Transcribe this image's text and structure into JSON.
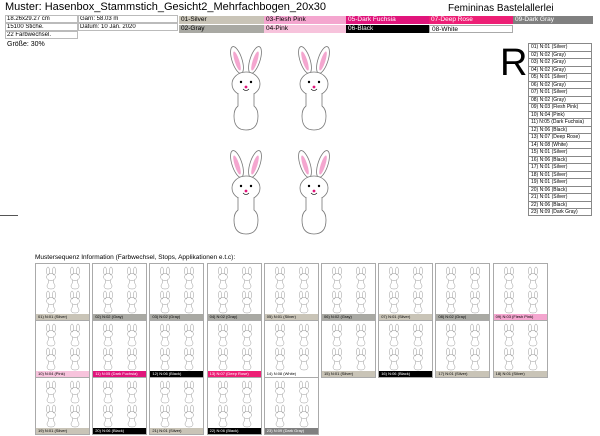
{
  "header": {
    "title": "Muster: Hasenbox_Stammstich_Gesicht2_Mehrfachbogen_20x30",
    "brand": "Femininas Bastelallerlei",
    "size": "18.26x29.27 cm",
    "garn": "Garn: 58.03 m",
    "stitches": "15100 Stiche.",
    "date": "Datum: 10 Jan. 2020",
    "color_changes": "22 Farbwechsel.",
    "scale": "Größe: 30%"
  },
  "swatches": [
    {
      "label": "01-Silver",
      "bg": "#c9c4b7",
      "fg": "#000000"
    },
    {
      "label": "03-Flesh Pink",
      "bg": "#f4a6cf",
      "fg": "#000000"
    },
    {
      "label": "05-Dark Fuchsia",
      "bg": "#e0157b",
      "fg": "#ffffff"
    },
    {
      "label": "07-Deep Rose",
      "bg": "#ed1f75",
      "fg": "#ffffff"
    },
    {
      "label": "09-Dark Gray",
      "bg": "#808080",
      "fg": "#ffffff"
    },
    {
      "label": "02-Gray",
      "bg": "#a9a9a3",
      "fg": "#000000"
    },
    {
      "label": "04-Pink",
      "bg": "#f7c3dc",
      "fg": "#000000"
    },
    {
      "label": "06-Black",
      "bg": "#000000",
      "fg": "#ffffff"
    },
    {
      "label": "08-White",
      "bg": "#ffffff",
      "fg": "#000000"
    }
  ],
  "big_letter": "R",
  "sequence": [
    "01) N:01 (Silver)",
    "02) N:02 (Gray)",
    "03) N:02 (Gray)",
    "04) N:02 (Gray)",
    "05) N:01 (Silver)",
    "06) N:02 (Gray)",
    "07) N:01 (Silver)",
    "08) N:02 (Gray)",
    "09) N:03 (Flesh Pink)",
    "10) N:04 (Pink)",
    "11) N:05 (Dark Fuchsia)",
    "12) N:06 (Black)",
    "13) N:07 (Deep Rose)",
    "14) N:08 (White)",
    "15) N:01 (Silver)",
    "16) N:06 (Black)",
    "17) N:01 (Silver)",
    "18) N:01 (Silver)",
    "19) N:01 (Silver)",
    "20) N:06 (Black)",
    "21) N:01 (Silver)",
    "22) N:06 (Black)",
    "23) N:09 (Dark Gray)"
  ],
  "seq_info_title": "Mustersequenz Information (Farbwechsel, Stops, Applikationen e.t.c):",
  "thumbs": [
    {
      "label": "01) N:01 (Silver)",
      "bg": "#c9c4b7",
      "fg": "#000"
    },
    {
      "label": "02) N:02 (Gray)",
      "bg": "#a9a9a3",
      "fg": "#000"
    },
    {
      "label": "03) N:02 (Gray)",
      "bg": "#a9a9a3",
      "fg": "#000"
    },
    {
      "label": "04) N:02 (Gray)",
      "bg": "#a9a9a3",
      "fg": "#000"
    },
    {
      "label": "05) N:01 (Silver)",
      "bg": "#c9c4b7",
      "fg": "#000"
    },
    {
      "label": "06) N:02 (Gray)",
      "bg": "#a9a9a3",
      "fg": "#000"
    },
    {
      "label": "07) N:01 (Silver)",
      "bg": "#c9c4b7",
      "fg": "#000"
    },
    {
      "label": "08) N:02 (Gray)",
      "bg": "#a9a9a3",
      "fg": "#000"
    },
    {
      "label": "09) N:03 (Flesh Pink)",
      "bg": "#f4a6cf",
      "fg": "#000"
    },
    {
      "label": "10) N:04 (Pink)",
      "bg": "#f7c3dc",
      "fg": "#000"
    },
    {
      "label": "11) N:05 (Dark Fuchsia)",
      "bg": "#e0157b",
      "fg": "#fff"
    },
    {
      "label": "12) N:06 (Black)",
      "bg": "#000000",
      "fg": "#fff"
    },
    {
      "label": "13) N:07 (Deep Rose)",
      "bg": "#ed1f75",
      "fg": "#fff"
    },
    {
      "label": "14) N:08 (White)",
      "bg": "#ffffff",
      "fg": "#000"
    },
    {
      "label": "15) N:01 (Silver)",
      "bg": "#c9c4b7",
      "fg": "#000"
    },
    {
      "label": "16) N:06 (Black)",
      "bg": "#000000",
      "fg": "#fff"
    },
    {
      "label": "17) N:01 (Silver)",
      "bg": "#c9c4b7",
      "fg": "#000"
    },
    {
      "label": "18) N:01 (Silver)",
      "bg": "#c9c4b7",
      "fg": "#000"
    },
    {
      "label": "19) N:01 (Silver)",
      "bg": "#c9c4b7",
      "fg": "#000"
    },
    {
      "label": "20) N:06 (Black)",
      "bg": "#000000",
      "fg": "#fff"
    },
    {
      "label": "21) N:01 (Silver)",
      "bg": "#c9c4b7",
      "fg": "#000"
    },
    {
      "label": "22) N:06 (Black)",
      "bg": "#000000",
      "fg": "#fff"
    },
    {
      "label": "23) N:09 (Dark Gray)",
      "bg": "#808080",
      "fg": "#fff"
    }
  ]
}
